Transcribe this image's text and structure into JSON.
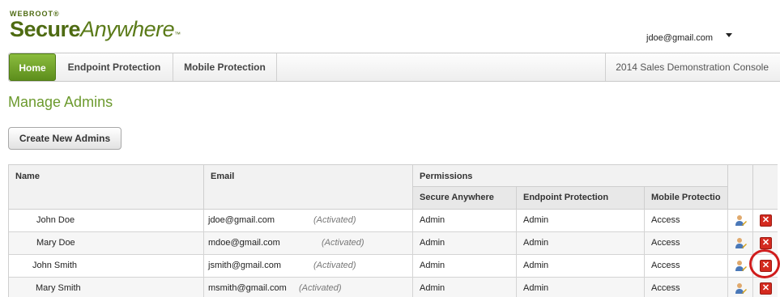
{
  "brand": {
    "small": "WEBROOT",
    "reg": "®",
    "main_bold": "Secure",
    "main_italic": "Anywhere",
    "tm": "™"
  },
  "user": {
    "email": "jdoe@gmail.com"
  },
  "nav": {
    "tabs": [
      {
        "label": "Home",
        "active": true
      },
      {
        "label": "Endpoint Protection",
        "active": false
      },
      {
        "label": "Mobile Protection",
        "active": false
      }
    ],
    "console_title": "2014 Sales Demonstration Console"
  },
  "page": {
    "title": "Manage Admins",
    "create_button": "Create New Admins"
  },
  "table": {
    "headers": {
      "name": "Name",
      "email": "Email",
      "permissions": "Permissions",
      "secure_anywhere": "Secure Anywhere",
      "endpoint_protection": "Endpoint Protection",
      "mobile_protection": "Mobile Protectio"
    },
    "rows": [
      {
        "name": "John Doe",
        "email": "jdoe@gmail.com",
        "status": "(Activated)",
        "secure_anywhere": "Admin",
        "endpoint": "Admin",
        "mobile": "Access"
      },
      {
        "name": "Mary Doe",
        "email": "mdoe@gmail.com",
        "status": "(Activated)",
        "secure_anywhere": "Admin",
        "endpoint": "Admin",
        "mobile": "Access"
      },
      {
        "name": "John Smith",
        "email": "jsmith@gmail.com",
        "status": "(Activated)",
        "secure_anywhere": "Admin",
        "endpoint": "Admin",
        "mobile": "Access"
      },
      {
        "name": "Mary Smith",
        "email": "msmith@gmail.com",
        "status": "(Activated)",
        "secure_anywhere": "Admin",
        "endpoint": "Admin",
        "mobile": "Access"
      }
    ]
  },
  "icons": {
    "edit": "user-edit-icon",
    "delete": "delete-icon",
    "caret": "caret-down-icon"
  },
  "colors": {
    "brand_green": "#6c9a2e",
    "tab_active": "#5d8e1c",
    "delete_red": "#d42a1f",
    "highlight_ring": "#d01c1c"
  }
}
